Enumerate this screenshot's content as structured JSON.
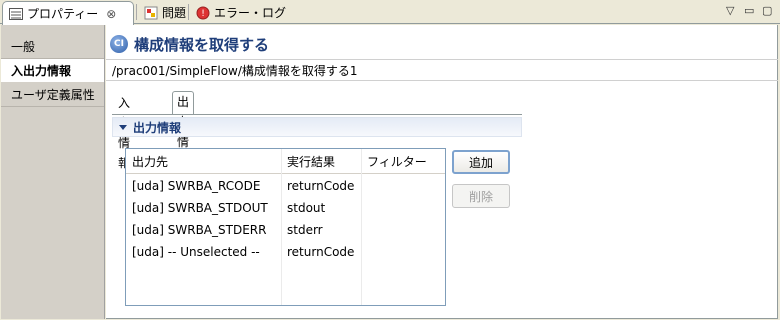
{
  "top_tabs": [
    {
      "label": "プロパティー",
      "icon": "properties-icon",
      "active": true,
      "close": "⊗"
    },
    {
      "label": "問題",
      "icon": "problems-icon",
      "active": false
    },
    {
      "label": "エラー・ログ",
      "icon": "error-log-icon",
      "active": false
    }
  ],
  "window_controls": {
    "view_menu": "▽",
    "minimize": "▭",
    "maximize": "▢"
  },
  "left_panel": {
    "items": [
      {
        "label": "一般",
        "selected": false
      },
      {
        "label": "入出力情報",
        "selected": true
      },
      {
        "label": "ユーザ定義属性",
        "selected": false
      }
    ]
  },
  "header": {
    "icon_text": "CI",
    "title": "構成情報を取得する"
  },
  "path": "/prac001/SimpleFlow/構成情報を取得する1",
  "sub_tabs": [
    {
      "label": "入力情報",
      "active": false
    },
    {
      "label": "出力情報",
      "active": true
    }
  ],
  "section": {
    "title": "出力情報"
  },
  "table": {
    "columns": [
      "出力先",
      "実行結果",
      "フィルター"
    ],
    "rows": [
      {
        "dest": "[uda] SWRBA_RCODE",
        "result": "returnCode",
        "filter": ""
      },
      {
        "dest": "[uda] SWRBA_STDOUT",
        "result": "stdout",
        "filter": ""
      },
      {
        "dest": "[uda] SWRBA_STDERR",
        "result": "stderr",
        "filter": ""
      },
      {
        "dest": "[uda] -- Unselected --",
        "result": "returnCode",
        "filter": ""
      }
    ]
  },
  "buttons": {
    "add": "追加",
    "delete": "削除"
  },
  "colors": {
    "accent": "#1f3e7a",
    "panel_bg": "#d4d0c8",
    "chrome_bg": "#ece9d8"
  }
}
